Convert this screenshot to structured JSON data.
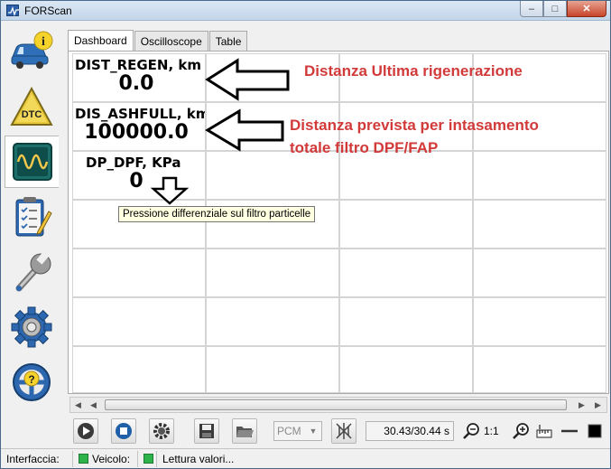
{
  "window": {
    "title": "FORScan",
    "min_glyph": "‒",
    "max_glyph": "□",
    "close_glyph": "✕"
  },
  "sidebar": {
    "items": [
      {
        "name": "vehicle-info",
        "icon": "car-info-icon"
      },
      {
        "name": "dtc",
        "icon": "dtc-warning-icon",
        "label": "DTC"
      },
      {
        "name": "oscilloscope",
        "icon": "oscilloscope-icon"
      },
      {
        "name": "checklist",
        "icon": "checklist-icon"
      },
      {
        "name": "service",
        "icon": "wrench-icon"
      },
      {
        "name": "settings",
        "icon": "gear-icon"
      },
      {
        "name": "help",
        "icon": "help-wheel-icon"
      }
    ],
    "active": "oscilloscope"
  },
  "tabs": [
    {
      "label": "Dashboard",
      "active": true
    },
    {
      "label": "Oscilloscope",
      "active": false
    },
    {
      "label": "Table",
      "active": false
    }
  ],
  "gauges": [
    {
      "label": "DIST_REGEN, km",
      "value": "0.0"
    },
    {
      "label": "DIS_ASHFULL, km",
      "value": "100000.0"
    },
    {
      "label": "DP_DPF, KPa",
      "value": "0"
    }
  ],
  "annotations": {
    "regen": "Distanza Ultima rigenerazione",
    "ashfull_line1": "Distanza prevista per intasamento",
    "ashfull_line2": "totale filtro DPF/FAP",
    "color": "#d23a3a"
  },
  "tooltip": "Pressione differenziale sul filtro particelle",
  "toolbar": {
    "protocol": "PCM",
    "ratio": "30.43/30.44 s",
    "zoom": "1:1"
  },
  "status": {
    "interface_label": "Interfaccia:",
    "vehicle_label": "Veicolo:",
    "message": "Lettura valori...",
    "led_color": "#2db34a"
  }
}
